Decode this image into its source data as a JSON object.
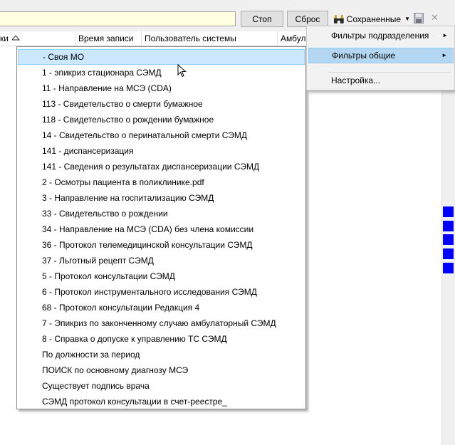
{
  "toolbar": {
    "search_value": "",
    "stop_label": "Стоп",
    "reset_label": "Сброс",
    "saved_label": "Сохраненные",
    "close_glyph": "✕"
  },
  "grid": {
    "columns": [
      "ки",
      "Время записи",
      "Пользователь системы",
      "Амбула"
    ]
  },
  "dropdown": {
    "items": [
      "- Своя МО",
      "1 - эпикриз стационара СЭМД",
      "11 - Направление на МСЭ (CDA)",
      "113 - Свидетельство о смерти бумажное",
      "118 - Свидетельство о рождении бумажное",
      "14 - Свидетельство о перинатальной смерти СЭМД",
      "141 - диспансеризация",
      "141 - Сведения о результатах диспансеризации СЭМД",
      "2 - Осмотры пациента в поликлинике.pdf",
      "3 - Направление на госпитализацию СЭМД",
      "33 - Свидетельство о рождении",
      "34 - Направление на МСЭ (CDA) без члена комиссии",
      "36 - Протокол телемедицинской консультации СЭМД",
      "37 - Льготный рецепт СЭМД",
      "5 - Протокол консультации СЭМД",
      "6 - Протокол инструментального исследования СЭМД",
      "68 - Протокол консультации Редакция 4",
      "7 - Эпикриз по законченному случаю амбулаторный СЭМД",
      "8 - Справка о допуске к управлению ТС СЭМД",
      "По должности за период",
      "ПОИСК по основному диагнозу МСЭ",
      "Существует подпись врача",
      "СЭМД протокол консультации в счет-реестре_"
    ]
  },
  "context_menu": {
    "items": [
      {
        "label": "Фильтры подразделения"
      },
      {
        "label": "Фильтры общие"
      },
      {
        "label": "Настройка..."
      }
    ]
  },
  "colors": {
    "search_bg": "#ffffe1",
    "selected_bg": "#cce8ff",
    "menu_hover_bg": "#b3d7f3",
    "marker": "#0000ff"
  }
}
